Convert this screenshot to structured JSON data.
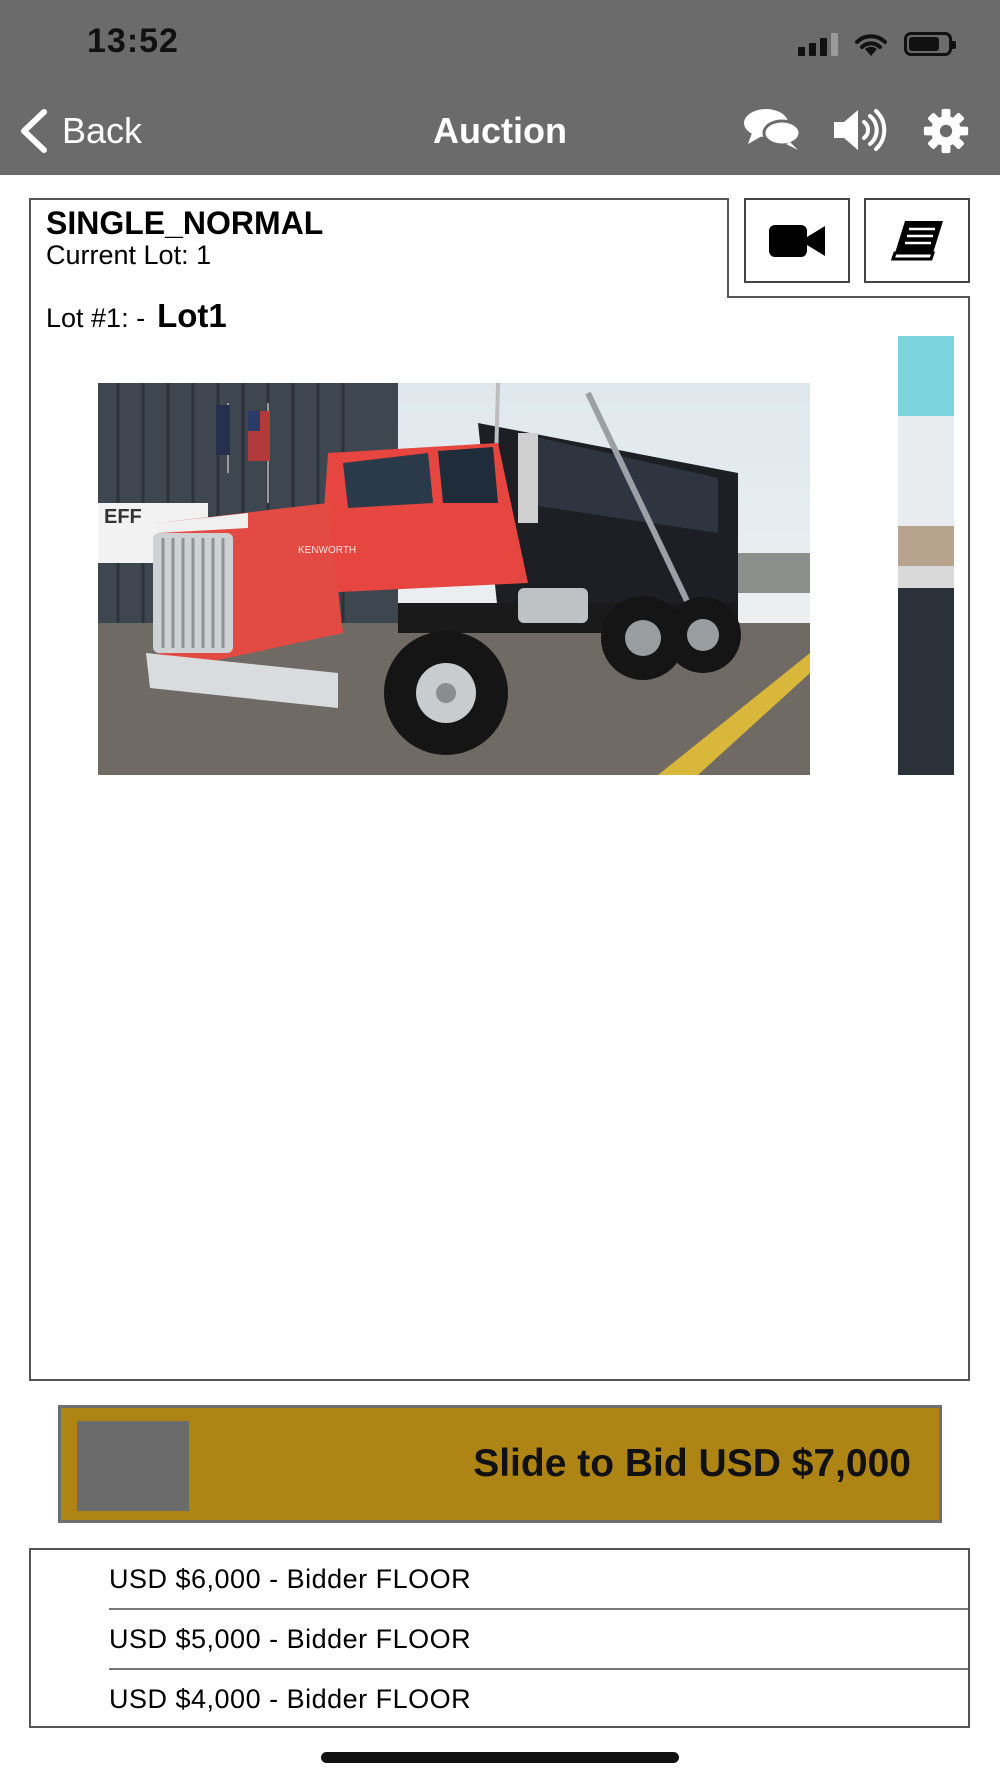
{
  "status_bar": {
    "time": "13:52"
  },
  "header": {
    "back_label": "Back",
    "title": "Auction",
    "icons": [
      "chat-icon",
      "speaker-icon",
      "gear-icon"
    ]
  },
  "auction": {
    "name": "SINGLE_NORMAL",
    "current_lot": "Current Lot: 1",
    "lot_prefix": "Lot #1: -",
    "lot_title": "Lot1",
    "tools": [
      "video-camera-icon",
      "catalog-book-icon"
    ]
  },
  "bid_slider": {
    "label": "Slide to Bid USD $7,000"
  },
  "bid_history": [
    "USD $6,000 - Bidder FLOOR",
    "USD $5,000 - Bidder FLOOR",
    "USD $4,000 - Bidder FLOOR"
  ],
  "colors": {
    "header_bg": "#6b6b6b",
    "slider_bg": "#ae8514",
    "knob": "#6b6b6b"
  }
}
